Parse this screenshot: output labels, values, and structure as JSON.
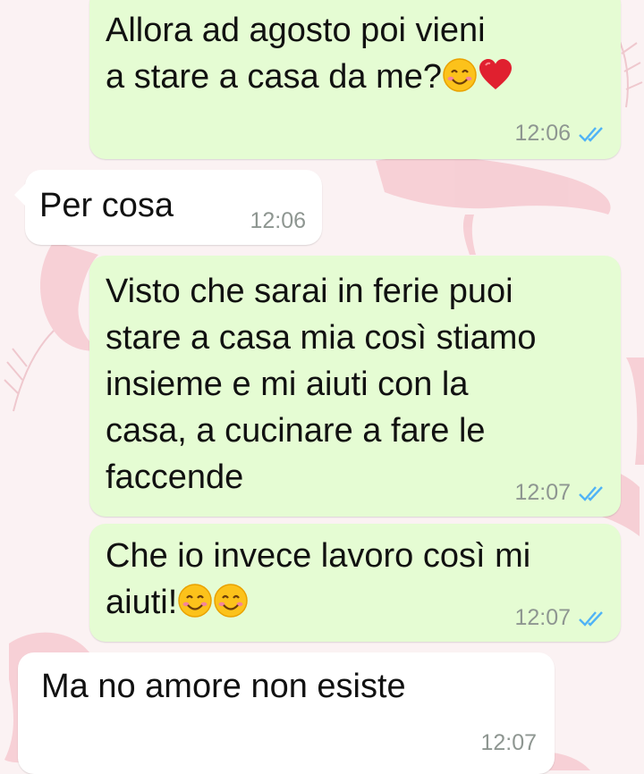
{
  "messages": [
    {
      "direction": "outgoing",
      "text": "Allora ad agosto poi vieni\na stare a casa da me?",
      "time": "12:06",
      "status": "read"
    },
    {
      "direction": "incoming",
      "text": "Per cosa",
      "time": "12:06"
    },
    {
      "direction": "outgoing",
      "text": "Visto che sarai in ferie puoi\nstare a casa mia così stiamo\ninsieme e mi aiuti con la\ncasa, a cucinare a fare le\nfaccende",
      "time": "12:07",
      "status": "read"
    },
    {
      "direction": "outgoing",
      "text": "Che io invece lavoro così mi\naiuti!",
      "time": "12:07",
      "status": "read"
    },
    {
      "direction": "incoming",
      "text": "Ma no amore non esiste",
      "time": "12:07"
    }
  ],
  "emojis": {
    "msg1": [
      "smiling-face-icon",
      "red-heart-icon"
    ],
    "msg4": [
      "smiling-face-icon",
      "smiling-face-icon"
    ]
  },
  "colors": {
    "outgoing_bubble": "#e5fcd3",
    "incoming_bubble": "#ffffff",
    "read_ticks": "#4fb3f6",
    "timestamp": "#8e9691",
    "wallpaper": "#fbf2f3"
  }
}
